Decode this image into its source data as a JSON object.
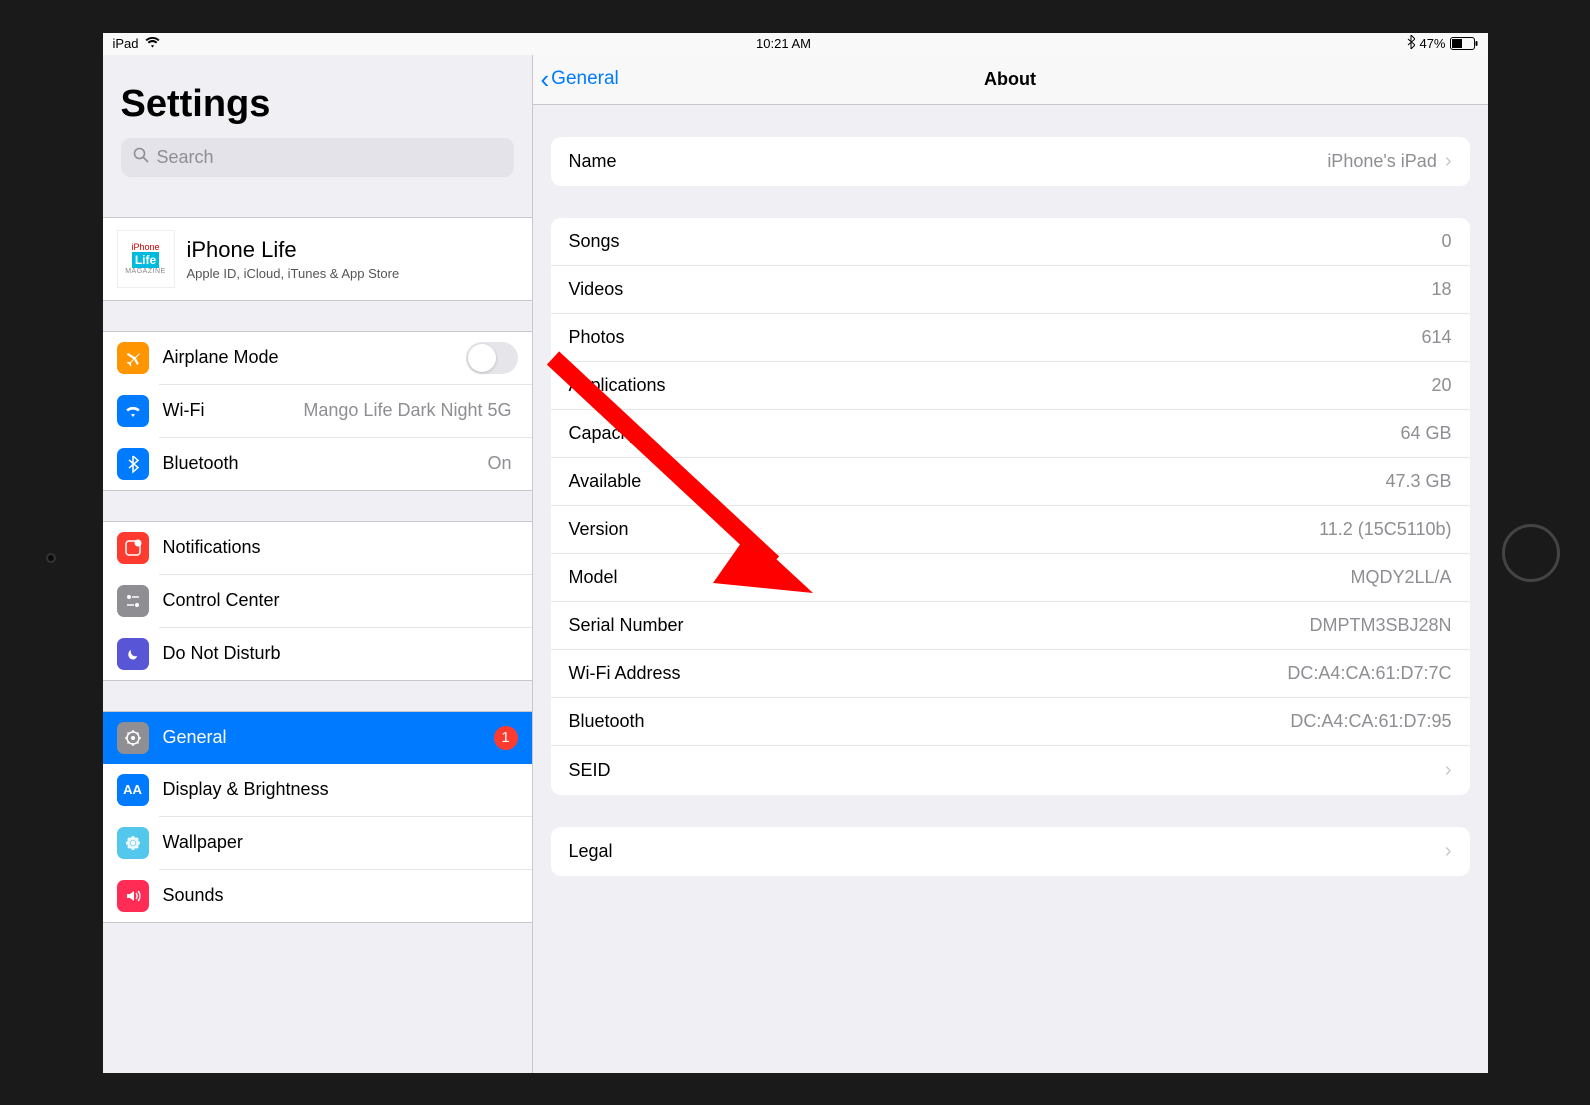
{
  "statusBar": {
    "device": "iPad",
    "time": "10:21 AM",
    "batteryPercent": "47%"
  },
  "sidebar": {
    "title": "Settings",
    "searchPlaceholder": "Search",
    "account": {
      "name": "iPhone Life",
      "subtitle": "Apple ID, iCloud, iTunes & App Store",
      "avatarTop": "iPhone",
      "avatarMid": "Life",
      "avatarBottom": "MAGAZINE"
    },
    "group1": [
      {
        "id": "airplane",
        "label": "Airplane Mode",
        "toggle": false,
        "iconColor": "#ff9500",
        "iconGlyph": "✈"
      },
      {
        "id": "wifi",
        "label": "Wi-Fi",
        "value": "Mango Life Dark Night 5G",
        "iconColor": "#007aff",
        "iconGlyph": "wifi"
      },
      {
        "id": "bluetooth",
        "label": "Bluetooth",
        "value": "On",
        "iconColor": "#007aff",
        "iconGlyph": "bt"
      }
    ],
    "group2": [
      {
        "id": "notifications",
        "label": "Notifications",
        "iconColor": "#ff3b30",
        "iconGlyph": "notif"
      },
      {
        "id": "control-center",
        "label": "Control Center",
        "iconColor": "#8e8e93",
        "iconGlyph": "cc"
      },
      {
        "id": "dnd",
        "label": "Do Not Disturb",
        "iconColor": "#5856d6",
        "iconGlyph": "moon"
      }
    ],
    "group3": [
      {
        "id": "general",
        "label": "General",
        "selected": true,
        "badge": "1",
        "iconColor": "#8e8e93",
        "iconGlyph": "gear"
      },
      {
        "id": "display",
        "label": "Display & Brightness",
        "iconColor": "#007aff",
        "iconGlyph": "AA"
      },
      {
        "id": "wallpaper",
        "label": "Wallpaper",
        "iconColor": "#54c7ec",
        "iconGlyph": "flower"
      },
      {
        "id": "sounds",
        "label": "Sounds",
        "iconColor": "#ff2d55",
        "iconGlyph": "sound"
      }
    ]
  },
  "detail": {
    "backLabel": "General",
    "title": "About",
    "groupA": [
      {
        "label": "Name",
        "value": "iPhone's iPad",
        "chevron": true
      }
    ],
    "groupB": [
      {
        "label": "Songs",
        "value": "0"
      },
      {
        "label": "Videos",
        "value": "18"
      },
      {
        "label": "Photos",
        "value": "614"
      },
      {
        "label": "Applications",
        "value": "20"
      },
      {
        "label": "Capacity",
        "value": "64 GB"
      },
      {
        "label": "Available",
        "value": "47.3 GB"
      },
      {
        "label": "Version",
        "value": "11.2 (15C5110b)"
      },
      {
        "label": "Model",
        "value": "MQDY2LL/A"
      },
      {
        "label": "Serial Number",
        "value": "DMPTM3SBJ28N"
      },
      {
        "label": "Wi-Fi Address",
        "value": "DC:A4:CA:61:D7:7C"
      },
      {
        "label": "Bluetooth",
        "value": "DC:A4:CA:61:D7:95"
      },
      {
        "label": "SEID",
        "value": "",
        "chevron": true
      }
    ],
    "groupC": [
      {
        "label": "Legal",
        "value": "",
        "chevron": true
      }
    ]
  }
}
